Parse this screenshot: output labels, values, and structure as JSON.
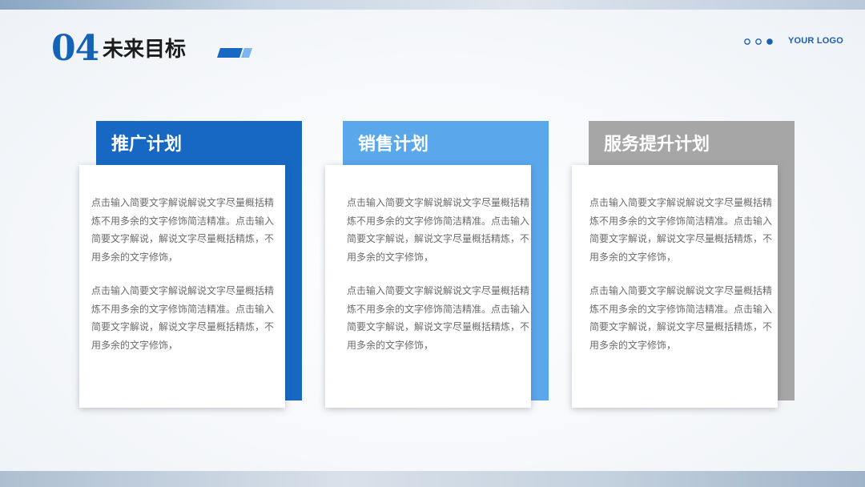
{
  "header": {
    "section_number": "04",
    "section_title": "未来目标",
    "logo_text": "YOUR LOGO",
    "dots_icon": "three-dots-indicator-icon"
  },
  "colors": {
    "accent_dark_blue": "#1768c2",
    "accent_light_blue": "#5aa7ec",
    "accent_gray": "#a6a6a6",
    "title_number": "#1563b6"
  },
  "cards": [
    {
      "title": "推广计划",
      "para1": "点击输入简要文字解说解说文字尽量概括精炼不用多余的文字修饰简洁精准。点击输入简要文字解说，解说文字尽量概括精炼，不用多余的文字修饰，",
      "para2": "点击输入简要文字解说解说文字尽量概括精炼不用多余的文字修饰简洁精准。点击输入简要文字解说，解说文字尽量概括精炼，不用多余的文字修饰，"
    },
    {
      "title": "销售计划",
      "para1": "点击输入简要文字解说解说文字尽量概括精炼不用多余的文字修饰简洁精准。点击输入简要文字解说，解说文字尽量概括精炼，不用多余的文字修饰，",
      "para2": "点击输入简要文字解说解说文字尽量概括精炼不用多余的文字修饰简洁精准。点击输入简要文字解说，解说文字尽量概括精炼，不用多余的文字修饰，"
    },
    {
      "title": "服务提升计划",
      "para1": "点击输入简要文字解说解说文字尽量概括精炼不用多余的文字修饰简洁精准。点击输入简要文字解说，解说文字尽量概括精炼，不用多余的文字修饰，",
      "para2": "点击输入简要文字解说解说文字尽量概括精炼不用多余的文字修饰简洁精准。点击输入简要文字解说，解说文字尽量概括精炼，不用多余的文字修饰，"
    }
  ]
}
